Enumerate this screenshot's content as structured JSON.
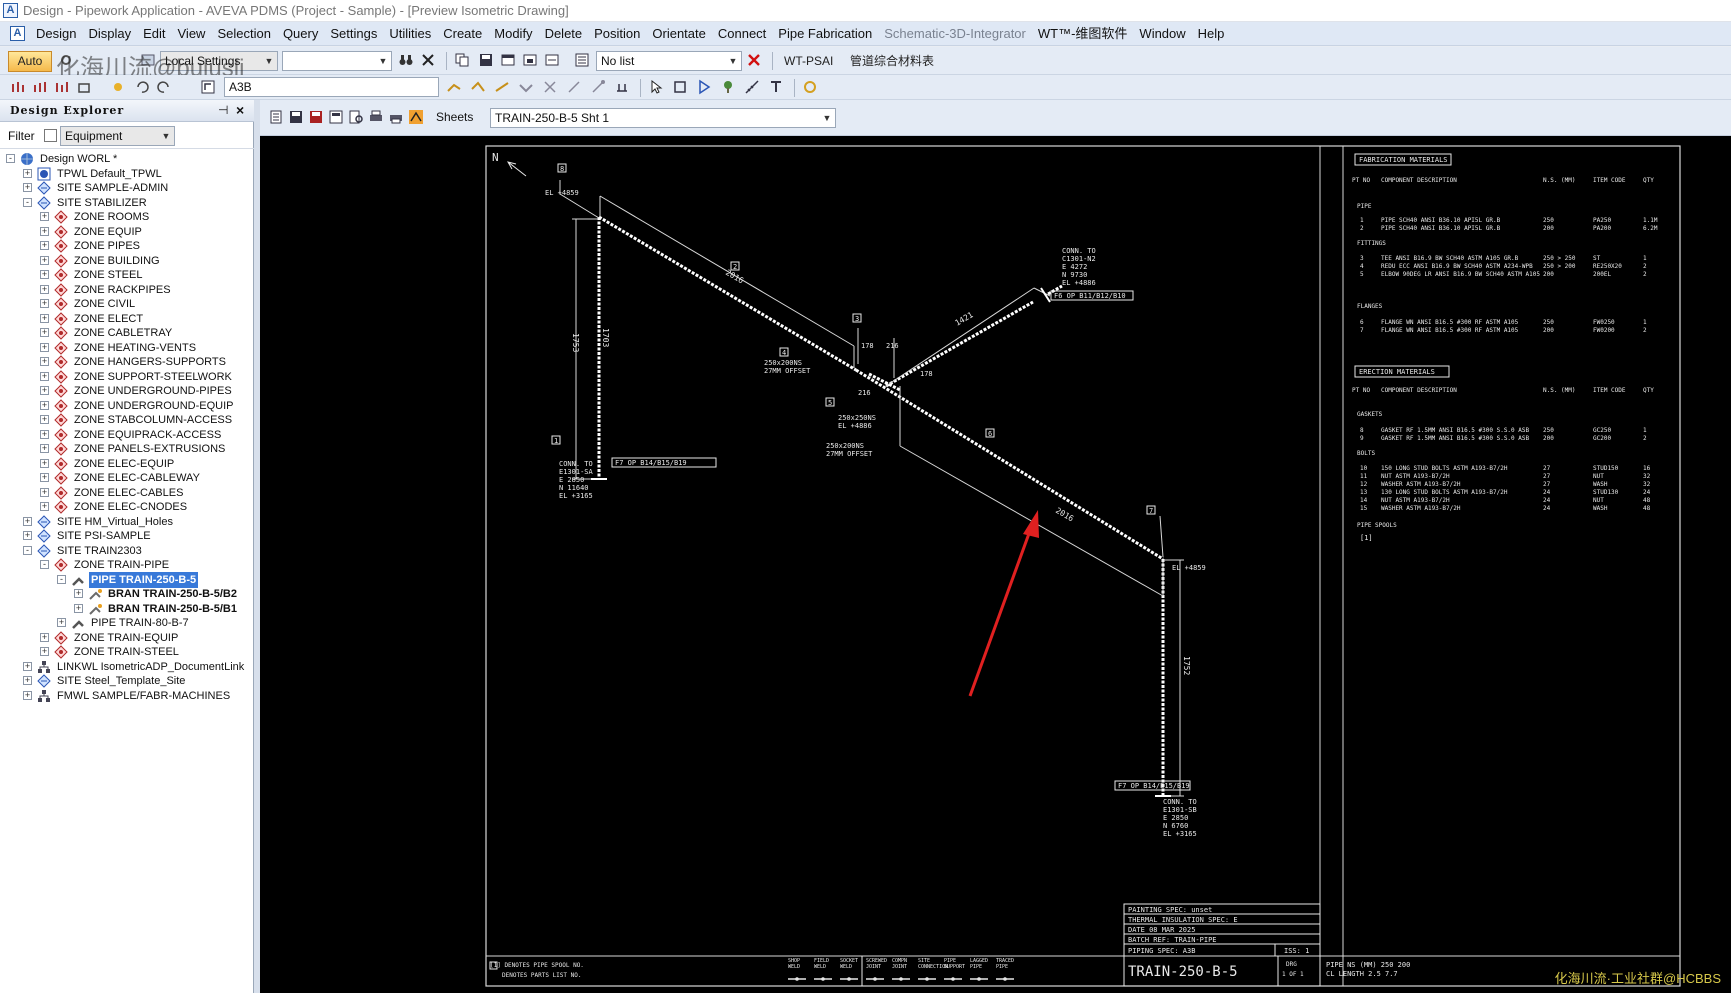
{
  "window": {
    "title": "Design - Pipework Application - AVEVA PDMS (Project - Sample) - [Preview Isometric Drawing]",
    "app_icon_letter": "A"
  },
  "menu": {
    "items": [
      {
        "label": "Design",
        "dim": false
      },
      {
        "label": "Display",
        "dim": false
      },
      {
        "label": "Edit",
        "dim": false
      },
      {
        "label": "View",
        "dim": false
      },
      {
        "label": "Selection",
        "dim": false
      },
      {
        "label": "Query",
        "dim": false
      },
      {
        "label": "Settings",
        "dim": false
      },
      {
        "label": "Utilities",
        "dim": false
      },
      {
        "label": "Create",
        "dim": false
      },
      {
        "label": "Modify",
        "dim": false
      },
      {
        "label": "Delete",
        "dim": false
      },
      {
        "label": "Position",
        "dim": false
      },
      {
        "label": "Orientate",
        "dim": false
      },
      {
        "label": "Connect",
        "dim": false
      },
      {
        "label": "Pipe Fabrication",
        "dim": false
      },
      {
        "label": "Schematic-3D-Integrator",
        "dim": true
      },
      {
        "label": "WT™-维图软件",
        "dim": false
      },
      {
        "label": "Window",
        "dim": false
      },
      {
        "label": "Help",
        "dim": false
      }
    ]
  },
  "toolbar1": {
    "auto_label": "Auto",
    "local_settings": "Local Settings",
    "list_combo": "No list",
    "wt_psai": "WT-PSAI",
    "material_table": "管道综合材料表"
  },
  "toolbar2": {
    "element_field": "A3B"
  },
  "watermark": {
    "top_left": "化海川流@bujusli",
    "bottom_right": "化海川流·工业社群@HCBBS"
  },
  "explorer": {
    "title": "Design Explorer",
    "filter_label": "Filter",
    "filter_value": "Equipment",
    "tree": [
      {
        "depth": 0,
        "label": "Design WORL *",
        "icon": "globe-icon",
        "exp": "-"
      },
      {
        "depth": 1,
        "label": "TPWL Default_TPWL",
        "icon": "world-icon",
        "exp": "+"
      },
      {
        "depth": 1,
        "label": "SITE SAMPLE-ADMIN",
        "icon": "site-icon",
        "exp": "+"
      },
      {
        "depth": 1,
        "label": "SITE STABILIZER",
        "icon": "site-icon",
        "exp": "-"
      },
      {
        "depth": 2,
        "label": "ZONE ROOMS",
        "icon": "zone-icon",
        "exp": "+"
      },
      {
        "depth": 2,
        "label": "ZONE EQUIP",
        "icon": "zone-icon",
        "exp": "+"
      },
      {
        "depth": 2,
        "label": "ZONE PIPES",
        "icon": "zone-icon",
        "exp": "+"
      },
      {
        "depth": 2,
        "label": "ZONE BUILDING",
        "icon": "zone-icon",
        "exp": "+"
      },
      {
        "depth": 2,
        "label": "ZONE STEEL",
        "icon": "zone-icon",
        "exp": "+"
      },
      {
        "depth": 2,
        "label": "ZONE RACKPIPES",
        "icon": "zone-icon",
        "exp": "+"
      },
      {
        "depth": 2,
        "label": "ZONE CIVIL",
        "icon": "zone-icon",
        "exp": "+"
      },
      {
        "depth": 2,
        "label": "ZONE ELECT",
        "icon": "zone-icon",
        "exp": "+"
      },
      {
        "depth": 2,
        "label": "ZONE CABLETRAY",
        "icon": "zone-icon",
        "exp": "+"
      },
      {
        "depth": 2,
        "label": "ZONE HEATING-VENTS",
        "icon": "zone-icon",
        "exp": "+"
      },
      {
        "depth": 2,
        "label": "ZONE HANGERS-SUPPORTS",
        "icon": "zone-icon",
        "exp": "+"
      },
      {
        "depth": 2,
        "label": "ZONE SUPPORT-STEELWORK",
        "icon": "zone-icon",
        "exp": "+"
      },
      {
        "depth": 2,
        "label": "ZONE UNDERGROUND-PIPES",
        "icon": "zone-icon",
        "exp": "+"
      },
      {
        "depth": 2,
        "label": "ZONE UNDERGROUND-EQUIP",
        "icon": "zone-icon",
        "exp": "+"
      },
      {
        "depth": 2,
        "label": "ZONE STABCOLUMN-ACCESS",
        "icon": "zone-icon",
        "exp": "+"
      },
      {
        "depth": 2,
        "label": "ZONE EQUIPRACK-ACCESS",
        "icon": "zone-icon",
        "exp": "+"
      },
      {
        "depth": 2,
        "label": "ZONE PANELS-EXTRUSIONS",
        "icon": "zone-icon",
        "exp": "+"
      },
      {
        "depth": 2,
        "label": "ZONE ELEC-EQUIP",
        "icon": "zone-icon",
        "exp": "+"
      },
      {
        "depth": 2,
        "label": "ZONE ELEC-CABLEWAY",
        "icon": "zone-icon",
        "exp": "+"
      },
      {
        "depth": 2,
        "label": "ZONE ELEC-CABLES",
        "icon": "zone-icon",
        "exp": "+"
      },
      {
        "depth": 2,
        "label": "ZONE ELEC-CNODES",
        "icon": "zone-icon",
        "exp": "+"
      },
      {
        "depth": 1,
        "label": "SITE HM_Virtual_Holes",
        "icon": "site-icon",
        "exp": "+"
      },
      {
        "depth": 1,
        "label": "SITE PSI-SAMPLE",
        "icon": "site-icon",
        "exp": "+"
      },
      {
        "depth": 1,
        "label": "SITE TRAIN2303",
        "icon": "site-icon",
        "exp": "-"
      },
      {
        "depth": 2,
        "label": "ZONE TRAIN-PIPE",
        "icon": "zone-icon",
        "exp": "-"
      },
      {
        "depth": 3,
        "label": "PIPE TRAIN-250-B-5",
        "icon": "pipe-icon",
        "exp": "-",
        "selected": true
      },
      {
        "depth": 4,
        "label": "BRAN TRAIN-250-B-5/B2",
        "icon": "branch-icon",
        "exp": "+",
        "bold": true
      },
      {
        "depth": 4,
        "label": "BRAN TRAIN-250-B-5/B1",
        "icon": "branch-icon",
        "exp": "+",
        "bold": true
      },
      {
        "depth": 3,
        "label": "PIPE TRAIN-80-B-7",
        "icon": "pipe-icon",
        "exp": "+"
      },
      {
        "depth": 2,
        "label": "ZONE TRAIN-EQUIP",
        "icon": "zone-icon",
        "exp": "+"
      },
      {
        "depth": 2,
        "label": "ZONE TRAIN-STEEL",
        "icon": "zone-icon",
        "exp": "+"
      },
      {
        "depth": 1,
        "label": "LINKWL IsometricADP_DocumentLink",
        "icon": "link-icon",
        "exp": "+"
      },
      {
        "depth": 1,
        "label": "SITE Steel_Template_Site",
        "icon": "site-icon",
        "exp": "+"
      },
      {
        "depth": 1,
        "label": "FMWL SAMPLE/FABR-MACHINES",
        "icon": "link-icon",
        "exp": "+"
      }
    ]
  },
  "viewer": {
    "sheets_label": "Sheets",
    "sheet_value": "TRAIN-250-B-5 Sht 1"
  },
  "iso": {
    "north": "N",
    "labels": {
      "el_top_left": "EL +4859",
      "dim_2016_a": "2016",
      "dim_1753": "1753",
      "dim_1703": "1703",
      "fg_left": "F7 OP B14/B15/B19",
      "conn_left": [
        "CONN. TO",
        "E1301-SA",
        "E 2850",
        "N 11640",
        "EL +3165"
      ],
      "conn_top_right": [
        "CONN. TO",
        "C1301-N2",
        "E 4272",
        "N 9730",
        "EL +4886"
      ],
      "fg_top_right": "F6 OP B11/B12/B10",
      "dim_1421": "1421",
      "dim_178a": "178",
      "dim_216a": "216",
      "dim_216b": "216",
      "dim_178b": "178",
      "red_a": [
        "250x200NS",
        "27MM OFFSET"
      ],
      "red_b": [
        "250x250NS",
        "EL +4886"
      ],
      "red_c": [
        "250x200NS",
        "27MM OFFSET"
      ],
      "dim_2016_b": "2016",
      "el_right": "EL +4859",
      "dim_1752": "1752",
      "fg_bottom_right": "F7 OP B14/B15/B19",
      "conn_bottom": [
        "CONN. TO",
        "E1301-SB",
        "E 2850",
        "N 6760",
        "EL +3165"
      ],
      "marker_1": "1",
      "marker_2": "2",
      "marker_3": "3",
      "marker_4": "4",
      "marker_5": "5",
      "marker_6": "6",
      "marker_7": "7",
      "marker_8": "8"
    },
    "bom": {
      "fab_title": "FABRICATION MATERIALS",
      "erect_title": "ERECTION MATERIALS",
      "headers": [
        "PT NO",
        "COMPONENT DESCRIPTION",
        "N.S. (MM)",
        "ITEM CODE",
        "QTY"
      ],
      "sec_pipe": "PIPE",
      "sec_fittings": "FITTINGS",
      "sec_flanges": "FLANGES",
      "sec_gaskets": "GASKETS",
      "sec_bolts": "BOLTS",
      "sec_spools": "PIPE SPOOLS",
      "spool_item": "[1]",
      "pipe_rows": [
        [
          "1",
          "PIPE SCH40 ANSI B36.10 API5L GR.B",
          "250",
          "PA250",
          "1.1M"
        ],
        [
          "2",
          "PIPE SCH40 ANSI B36.10 API5L GR.B",
          "200",
          "PA200",
          "6.2M"
        ]
      ],
      "fitting_rows": [
        [
          "3",
          "TEE ANSI B16.9 BW SCH40 ASTM A105 GR.B",
          "250 > 250",
          "ST",
          "1"
        ],
        [
          "4",
          "REDU ECC ANSI B16.9 BW SCH40 ASTM A234-WPB",
          "250 > 200",
          "RE250X20",
          "2"
        ],
        [
          "5",
          "ELBOW 90DEG LR ANSI B16.9 BW SCH40 ASTM A105",
          "200",
          "200EL",
          "2"
        ]
      ],
      "flange_rows": [
        [
          "6",
          "FLANGE WN ANSI B16.5 #300 RF ASTM A105",
          "250",
          "FW0250",
          "1"
        ],
        [
          "7",
          "FLANGE WN ANSI B16.5 #300 RF ASTM A105",
          "200",
          "FW0200",
          "2"
        ]
      ],
      "gasket_rows": [
        [
          "8",
          "GASKET RF 1.5MM ANSI B16.5 #300 S.S.0 ASB",
          "250",
          "GC250",
          "1"
        ],
        [
          "9",
          "GASKET RF 1.5MM ANSI B16.5 #300 S.S.0 ASB",
          "200",
          "GC200",
          "2"
        ]
      ],
      "bolt_rows": [
        [
          "10",
          "150 LONG STUD BOLTS ASTM A193-B7/2H",
          "27",
          "STUD150",
          "16"
        ],
        [
          "11",
          "NUT ASTM A193-B7/2H",
          "27",
          "NUT",
          "32"
        ],
        [
          "12",
          "WASHER ASTM A193-B7/2H",
          "27",
          "WASH",
          "32"
        ],
        [
          "13",
          "130 LONG STUD BOLTS ASTM A193-B7/2H",
          "24",
          "STUD130",
          "24"
        ],
        [
          "14",
          "NUT ASTM A193-B7/2H",
          "24",
          "NUT",
          "48"
        ],
        [
          "15",
          "WASHER ASTM A193-B7/2H",
          "24",
          "WASH",
          "48"
        ]
      ]
    },
    "title_block": {
      "painting": "PAINTING SPEC: unset",
      "insulation": "THERMAL INSULATION SPEC: E",
      "date": "DATE  08 MAR 2025",
      "batch": "BATCH REF:  TRAIN-PIPE",
      "piping_spec": "PIPING SPEC: A3B",
      "iss": "ISS: 1",
      "drawing_no": "TRAIN-250-B-5",
      "drg_label": "DRG",
      "drg_value": "1 OF 1",
      "pipe_ns": "PIPE NS (MM)  250  200",
      "cl_length": "CL LENGTH     2.5  7.7",
      "legend_1": "[1] DENOTES PIPE SPOOL NO.",
      "legend_2": "DENOTES PARTS LIST NO.",
      "symbols": [
        "SHOP WELD",
        "FIELD WELD",
        "SOCKET WELD",
        "SCREWED JOINT",
        "COMPN JOINT",
        "SITE CONNECTION",
        "PIPE SUPPORT",
        "LAGGED PIPE",
        "TRACED PIPE"
      ]
    }
  },
  "colors": {
    "selection": "#3879d9",
    "arrow": "#e02020",
    "drawing_bg": "#000000",
    "drawing_line": "#e8e8e8",
    "red_text": "#ff4a4a"
  }
}
